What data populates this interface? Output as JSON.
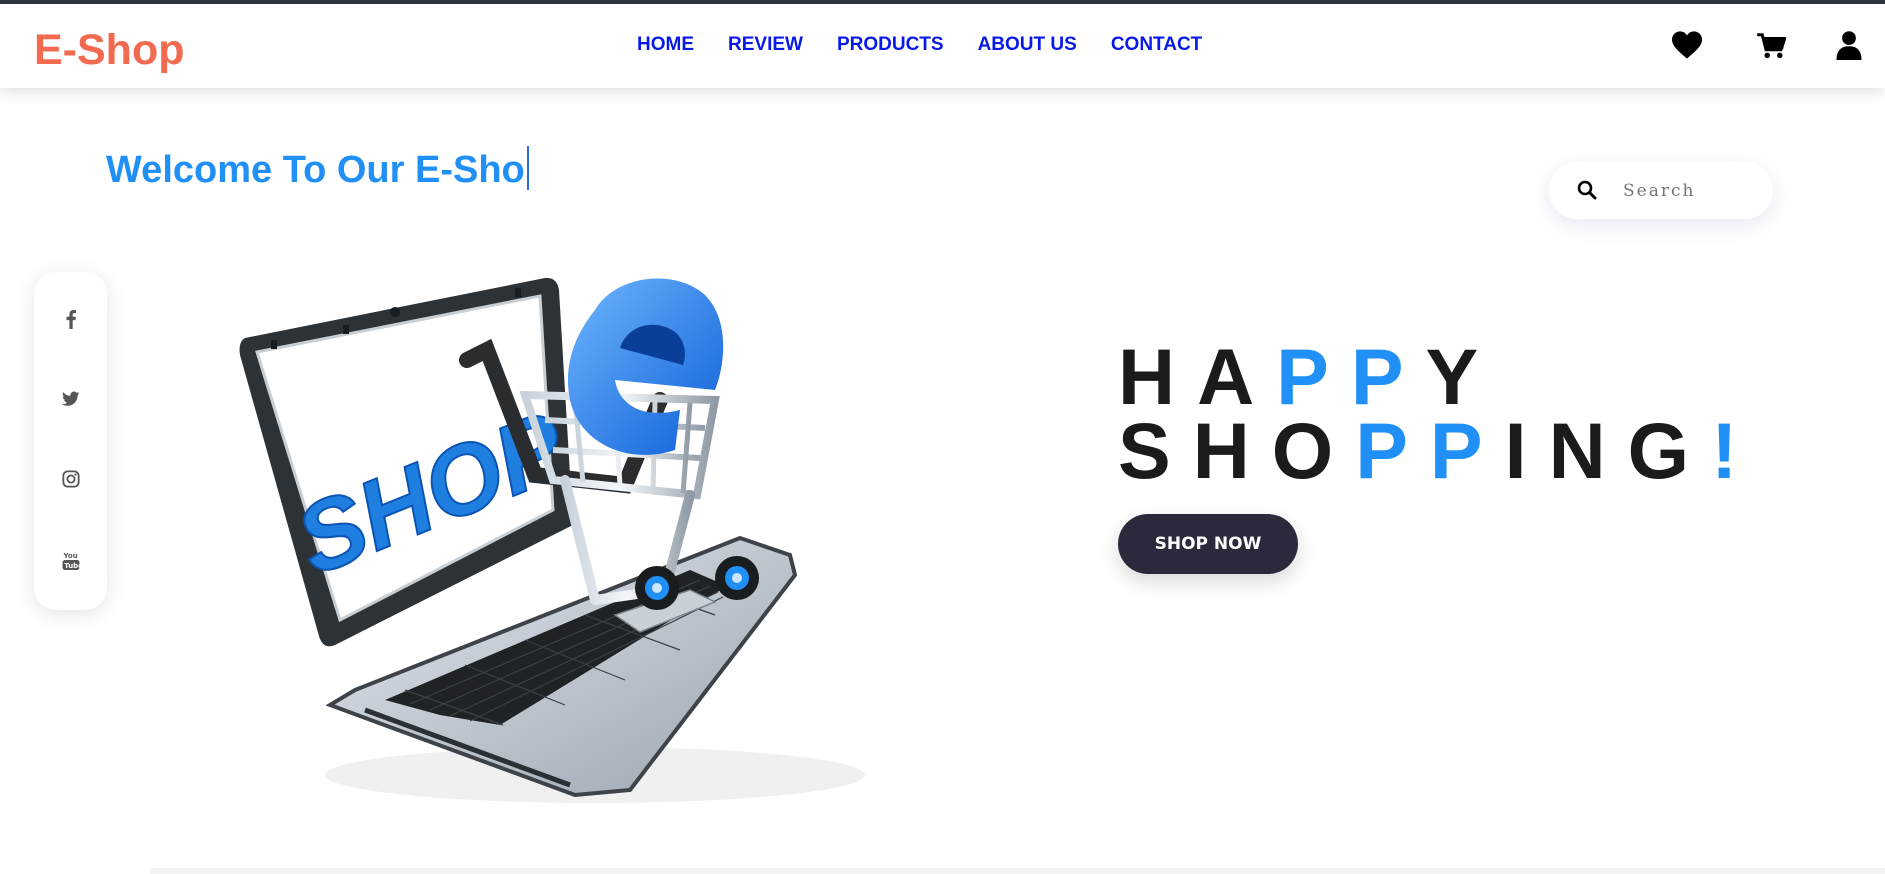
{
  "header": {
    "logo": "E-Shop",
    "nav": [
      "HOME",
      "REVIEW",
      "PRODUCTS",
      "ABOUT US",
      "CONTACT"
    ],
    "icons": [
      "heart-icon",
      "cart-icon",
      "user-icon"
    ]
  },
  "hero": {
    "welcome": "Welcome To Our E-Sho",
    "headline_line1": [
      "H",
      "A",
      "P",
      "P",
      "Y"
    ],
    "headline_line2": [
      "S",
      "H",
      "O",
      "P",
      "P",
      "I",
      "N",
      "G",
      "!"
    ],
    "shop_now": "SHOP NOW",
    "image_text": "SHOP"
  },
  "search": {
    "placeholder": "Search"
  },
  "social": [
    "facebook-icon",
    "twitter-icon",
    "instagram-icon",
    "youtube-icon"
  ],
  "colors": {
    "brand": "#f26a50",
    "accent": "#2190f6",
    "nav": "#0a1ae6",
    "button": "#2b2a3c"
  }
}
